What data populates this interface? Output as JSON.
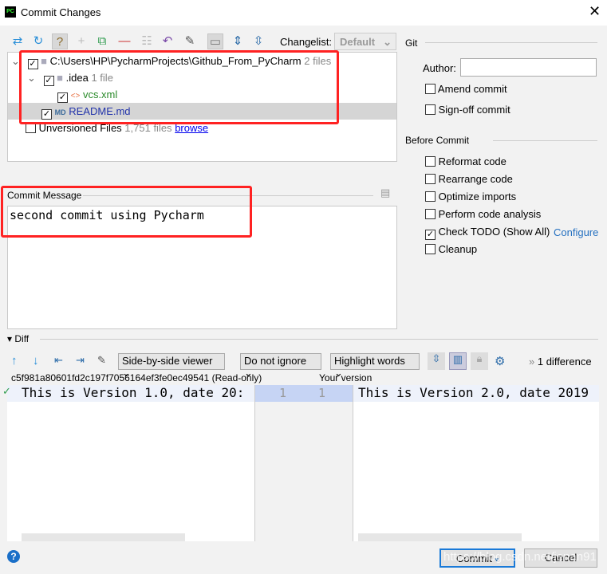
{
  "window": {
    "title": "Commit Changes"
  },
  "toolbar": {
    "changelist_label": "Changelist:",
    "changelist_value": "Default"
  },
  "tree": {
    "root": {
      "path": "C:\\Users\\HP\\PycharmProjects\\Github_From_PyCharm",
      "count": "2 files"
    },
    "idea": {
      "name": ".idea",
      "count": "1 file"
    },
    "vcs": {
      "name": "vcs.xml"
    },
    "readme": {
      "name": "README.md"
    },
    "unversioned": {
      "name": "Unversioned Files",
      "count": "1,751 files",
      "link": "browse"
    }
  },
  "commit_message": {
    "label": "Commit Message",
    "value": "second commit using Pycharm"
  },
  "git": {
    "header": "Git",
    "author_label": "Author:",
    "author_value": "",
    "amend": "Amend commit",
    "signoff": "Sign-off commit"
  },
  "before_commit": {
    "header": "Before Commit",
    "options": [
      {
        "label": "Reformat code",
        "checked": false
      },
      {
        "label": "Rearrange code",
        "checked": false
      },
      {
        "label": "Optimize imports",
        "checked": false
      },
      {
        "label": "Perform code analysis",
        "checked": false
      },
      {
        "label": "Check TODO (Show All)",
        "checked": true
      },
      {
        "label": "Cleanup",
        "checked": false
      }
    ],
    "configure_link": "Configure"
  },
  "diff": {
    "header": "Diff",
    "viewer": "Side-by-side viewer",
    "ignore": "Do not ignore",
    "highlight": "Highlight words",
    "differences": "1 difference",
    "left_title": "c5f981a80601fd2c197f7056164ef3fe0ec49541 (Read-only)",
    "right_title": "Your version",
    "left_line": "This is Version 1.0, date 20:",
    "right_line": "This is Version 2.0, date 2019",
    "left_num": "1",
    "right_num": "1"
  },
  "footer": {
    "commit": "Commit",
    "cancel": "Cancel",
    "help": "?",
    "watermark": "https://blog.csdn.net/jenan91"
  }
}
